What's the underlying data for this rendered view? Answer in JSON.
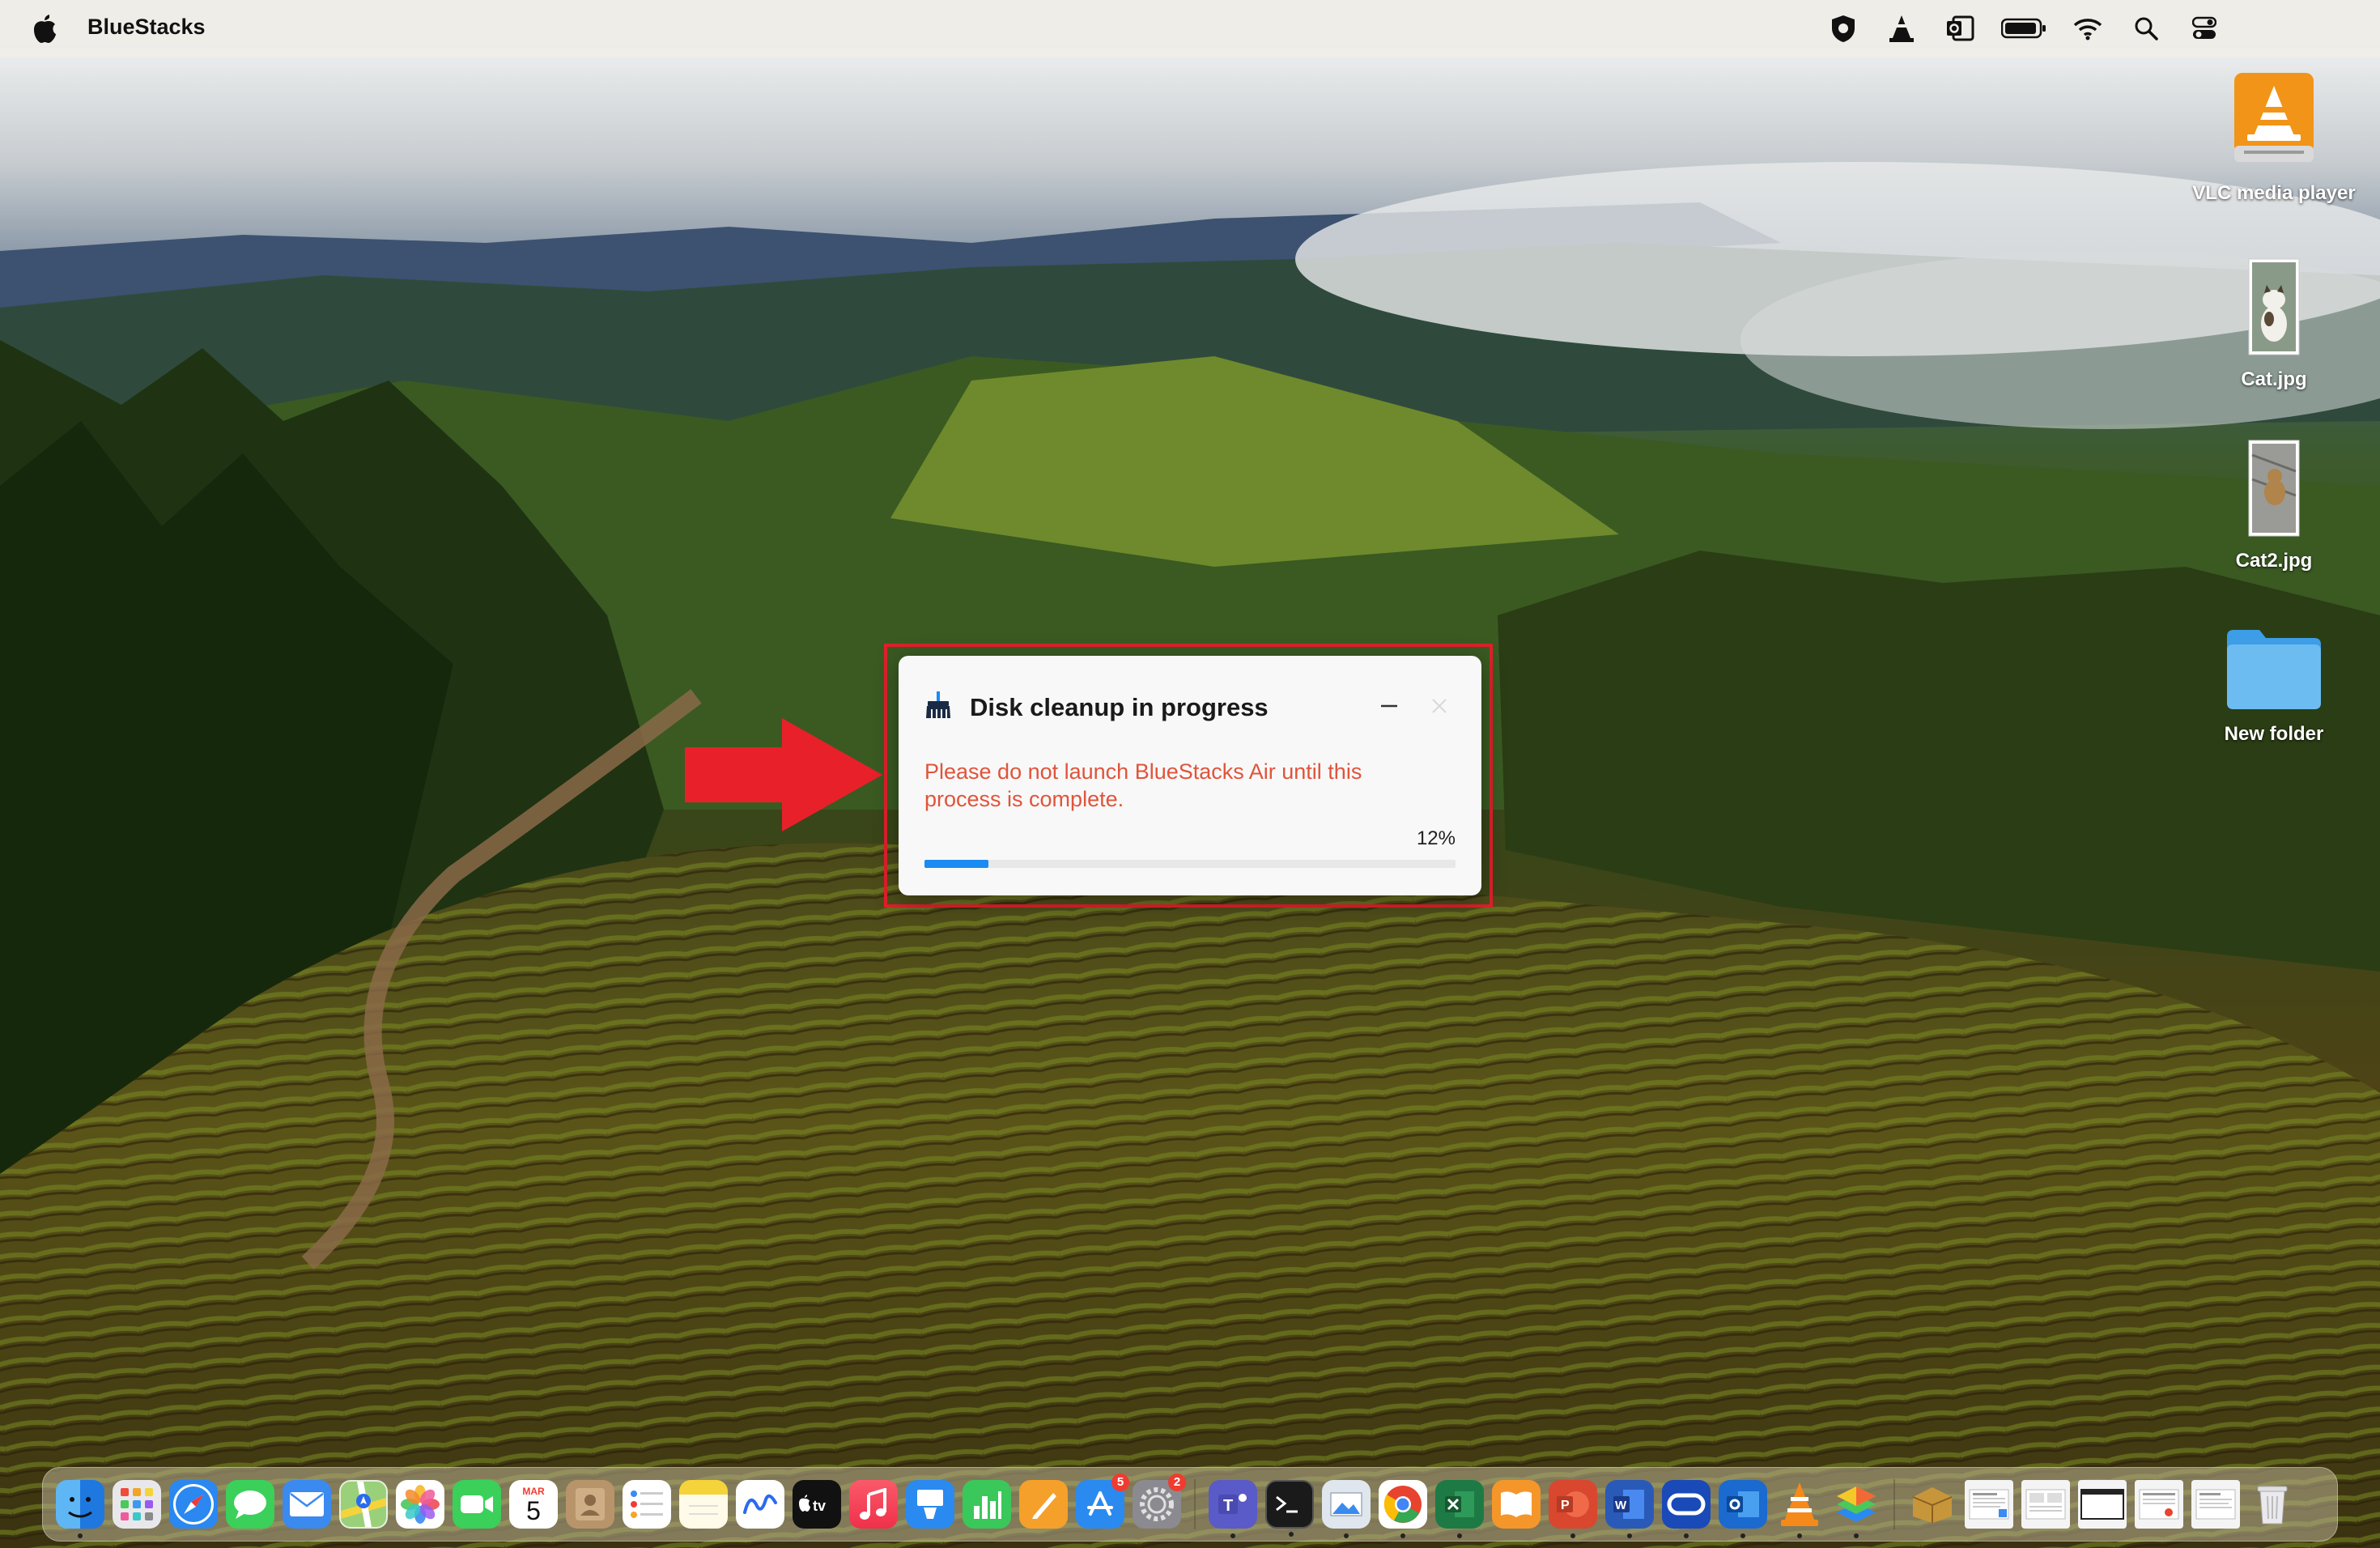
{
  "menubar": {
    "app_name": "BlueStacks",
    "status_icons": [
      "shield-icon",
      "vlc-cone-icon",
      "outlook-icon",
      "battery-icon",
      "wifi-icon",
      "search-icon",
      "control-center-icon"
    ]
  },
  "desktop_icons": [
    {
      "label": "VLC media player",
      "icon": "vlc-icon"
    },
    {
      "label": "Cat.jpg",
      "icon": "image-file-icon"
    },
    {
      "label": "Cat2.jpg",
      "icon": "image-file-icon"
    },
    {
      "label": "New folder",
      "icon": "folder-icon"
    }
  ],
  "dialog": {
    "title": "Disk cleanup in progress",
    "message": "Please do not launch BlueStacks Air until this process is complete.",
    "progress_label": "12%",
    "progress_value": 0.12,
    "accent_color": "#1a8bf0",
    "message_color": "#e0543b"
  },
  "annotation": {
    "frame_color": "#e0202a",
    "arrow_color": "#e8202a"
  },
  "dock": {
    "calendar_month": "MAR",
    "calendar_day": "5",
    "appstore_badge": "5",
    "settings_badge": "2",
    "items": [
      "finder",
      "launchpad",
      "safari",
      "messages",
      "mail",
      "maps",
      "photos",
      "facetime",
      "calendar",
      "contacts",
      "reminders",
      "notes",
      "freeform",
      "tv",
      "music",
      "keynote",
      "numbers",
      "pages",
      "app-store",
      "system-settings",
      "teams",
      "terminal",
      "preview",
      "chrome",
      "excel",
      "books",
      "powerpoint",
      "word",
      "oracle",
      "outlook",
      "vlc",
      "bluestacks",
      "archive",
      "doc-thumb-1",
      "doc-thumb-2",
      "doc-thumb-3",
      "doc-thumb-4",
      "doc-thumb-5",
      "trash"
    ]
  }
}
